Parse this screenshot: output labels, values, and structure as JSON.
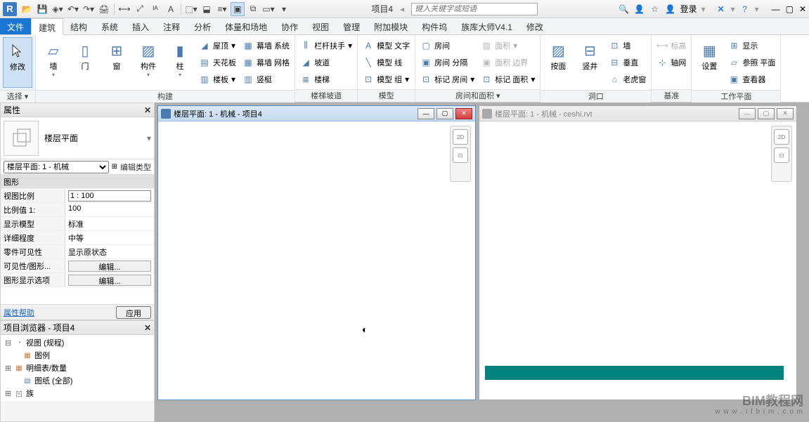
{
  "title": {
    "project": "项目4",
    "search_placeholder": "键入关键字或短语",
    "login": "登录"
  },
  "tabs": [
    "文件",
    "建筑",
    "结构",
    "系统",
    "插入",
    "注释",
    "分析",
    "体量和场地",
    "协作",
    "视图",
    "管理",
    "附加模块",
    "构件坞",
    "族库大师V4.1",
    "修改"
  ],
  "ribbon": {
    "select": {
      "modify": "修改",
      "select_label": "选择"
    },
    "build": {
      "wall": "墙",
      "door": "门",
      "window": "窗",
      "component": "构件",
      "column": "柱",
      "roof": "屋顶",
      "ceiling": "天花板",
      "floor": "楼板",
      "curtain_system": "幕墙 系统",
      "curtain_grid": "幕墙 网格",
      "mullion": "竖梃",
      "label": "构建"
    },
    "circulation": {
      "railing": "栏杆扶手",
      "ramp": "坡道",
      "stair": "楼梯",
      "label": "楼梯坡道"
    },
    "model": {
      "model_text": "模型 文字",
      "model_line": "模型 线",
      "model_group": "模型 组",
      "label": "模型"
    },
    "room_area": {
      "room": "房间",
      "room_sep": "房间 分隔",
      "tag_room": "标记 房间",
      "area": "面积",
      "area_boundary": "面积 边界",
      "tag_area": "标记 面积",
      "label": "房间和面积"
    },
    "opening": {
      "by_face": "按面",
      "vertical": "竖井",
      "wall_open": "墙",
      "vertical2": "垂直",
      "dormer": "老虎窗",
      "label": "洞口"
    },
    "datum": {
      "level": "标高",
      "grid": "轴网",
      "label": "基准"
    },
    "work_plane": {
      "show": "显示",
      "ref_plane": "参照 平面",
      "viewer": "查看器",
      "set": "设置",
      "label": "工作平面"
    }
  },
  "properties": {
    "title": "属性",
    "type_name": "楼层平面",
    "instance": "楼层平面: 1 - 机械",
    "edit_type": "编辑类型",
    "section_graphics": "图形",
    "rows": {
      "view_scale_label": "视图比例",
      "view_scale_value": "1 : 100",
      "scale_value_label": "比例值 1:",
      "scale_value_value": "100",
      "display_model_label": "显示模型",
      "display_model_value": "标准",
      "detail_level_label": "详细程度",
      "detail_level_value": "中等",
      "parts_vis_label": "零件可见性",
      "parts_vis_value": "显示原状态",
      "vis_graphics_label": "可见性/图形...",
      "vis_graphics_btn": "编辑...",
      "graphic_display_label": "图形显示选项",
      "graphic_display_btn": "编辑..."
    },
    "help_link": "属性帮助",
    "apply_btn": "应用"
  },
  "browser": {
    "title": "项目浏览器 - 项目4",
    "items": {
      "views": "视图 (规程)",
      "legends": "图例",
      "schedules": "明细表/数量",
      "sheets": "图纸 (全部)",
      "families": "族"
    }
  },
  "docwin1": {
    "title": "楼层平面: 1 - 机械 - 项目4"
  },
  "docwin2": {
    "title": "楼层平面: 1 - 机械 - ceshi.rvt"
  },
  "watermark": {
    "big": "BIM教程网",
    "small": "w w w . i f b i m . c o m"
  },
  "nav2d": "2D"
}
